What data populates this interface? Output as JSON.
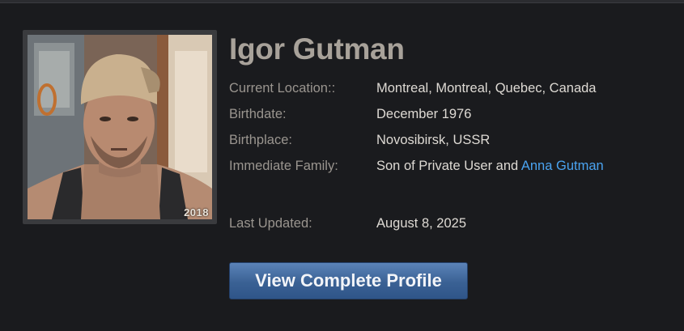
{
  "profile": {
    "name": "Igor Gutman",
    "photo_year": "2018",
    "fields": {
      "location_label": "Current Location::",
      "location_value": "Montreal, Montreal, Quebec, Canada",
      "birthdate_label": "Birthdate:",
      "birthdate_value": "December 1976",
      "birthplace_label": "Birthplace:",
      "birthplace_value": "Novosibirsk, USSR",
      "family_label": "Immediate Family:",
      "family_prefix": "Son of Private User and ",
      "family_link": "Anna Gutman",
      "updated_label": "Last Updated:",
      "updated_value": "August 8, 2025"
    },
    "button_label": "View Complete Profile"
  },
  "colors": {
    "background": "#1a1b1e",
    "name": "#a8a29a",
    "label": "#9a958f",
    "value": "#dedad4",
    "link": "#4aa3f0",
    "button": "#3a6194"
  }
}
